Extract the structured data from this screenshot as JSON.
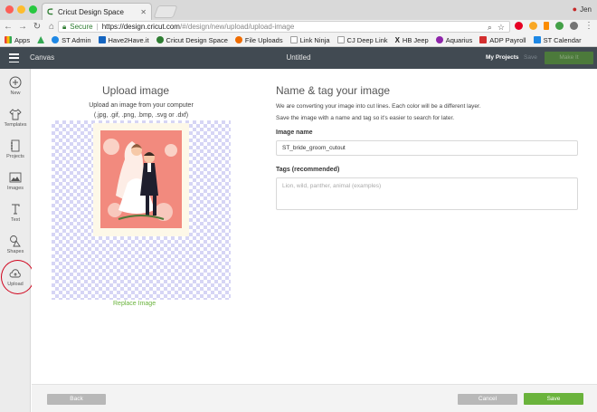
{
  "browser": {
    "tab_title": "Cricut Design Space",
    "profile_name": "Jen",
    "secure_label": "Secure",
    "url_host": "https://design.cricut.com",
    "url_path": "/#/design/new/upload/upload-image",
    "bookmarks": [
      {
        "label": "Apps",
        "color": "#4285f4"
      },
      {
        "label": "ST Admin",
        "color": "#1e88e5"
      },
      {
        "label": "Have2Have.it",
        "color": "#1565c0"
      },
      {
        "label": "Cricut Design Space",
        "color": "#2e7d32"
      },
      {
        "label": "File Uploads",
        "color": "#ef6c00"
      },
      {
        "label": "Link Ninja",
        "color": "#9e9e9e"
      },
      {
        "label": "CJ Deep Link",
        "color": "#9e9e9e"
      },
      {
        "label": "HB Jeep",
        "color": "#212121"
      },
      {
        "label": "Aquarius",
        "color": "#8e24aa"
      },
      {
        "label": "ADP Payroll",
        "color": "#d32f2f"
      },
      {
        "label": "ST Calendar",
        "color": "#1e88e5"
      }
    ]
  },
  "app": {
    "canvas_label": "Canvas",
    "doc_title": "Untitled",
    "my_projects": "My Projects",
    "save": "Save",
    "make_it": "Make It",
    "brand_green": "#6ab33c"
  },
  "sidebar": {
    "items": [
      {
        "label": "New",
        "icon": "plus-circle-icon"
      },
      {
        "label": "Templates",
        "icon": "shirt-icon"
      },
      {
        "label": "Projects",
        "icon": "notebook-icon"
      },
      {
        "label": "Images",
        "icon": "image-icon"
      },
      {
        "label": "Text",
        "icon": "text-t-icon"
      },
      {
        "label": "Shapes",
        "icon": "shapes-icon"
      },
      {
        "label": "Upload",
        "icon": "cloud-upload-icon"
      }
    ],
    "highlight_color": "#d0021b"
  },
  "upload": {
    "title": "Upload image",
    "subtitle_line1": "Upload an image from your computer",
    "subtitle_line2": "(.jpg, .gif, .png, .bmp, .svg or .dxf)",
    "replace_link": "Replace Image"
  },
  "form": {
    "title": "Name & tag your image",
    "desc_line1": "We are converting your image into cut lines. Each color will be a different layer.",
    "desc_line2": "Save the image with a name and tag so it's easier to search for later.",
    "name_label": "Image name",
    "name_value": "ST_bride_groom_cutout",
    "tags_label": "Tags (recommended)",
    "tags_placeholder": "Lion, wild, panther, animal (examples)"
  },
  "footer": {
    "back": "Back",
    "cancel": "Cancel",
    "save": "Save"
  }
}
